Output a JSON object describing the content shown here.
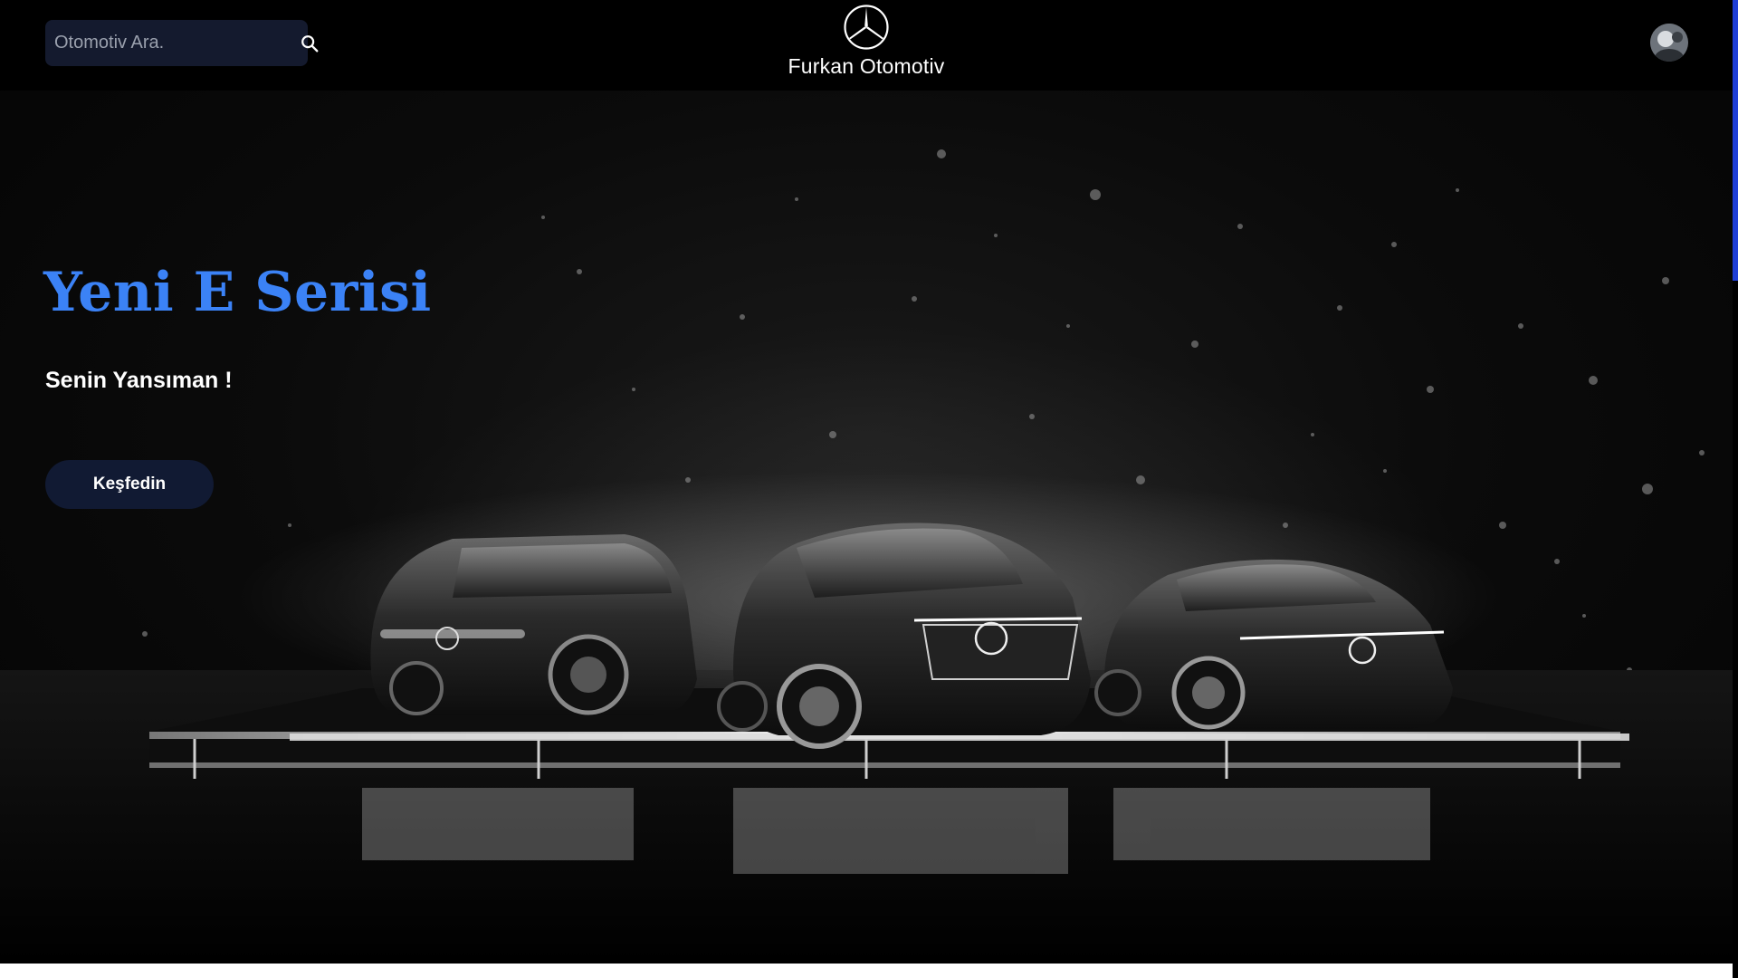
{
  "header": {
    "search_placeholder": "Otomotiv Ara.",
    "search_icon": "search-icon",
    "brand_logo_icon": "three-pointed-star-logo",
    "brand_name": "Furkan Otomotiv",
    "avatar_icon": "user-avatar"
  },
  "hero": {
    "title": "Yeni E Serisi",
    "subtitle": "Senin Yansıman !",
    "cta_label": "Keşfedin",
    "image_description_icon": "three-electric-suvs-on-lit-platform"
  },
  "colors": {
    "accent_blue": "#3b82f6",
    "search_bg": "#141a2e",
    "cta_bg": "#111a33",
    "background": "#000000",
    "scrollbar_thumb": "#1f3fd6"
  }
}
